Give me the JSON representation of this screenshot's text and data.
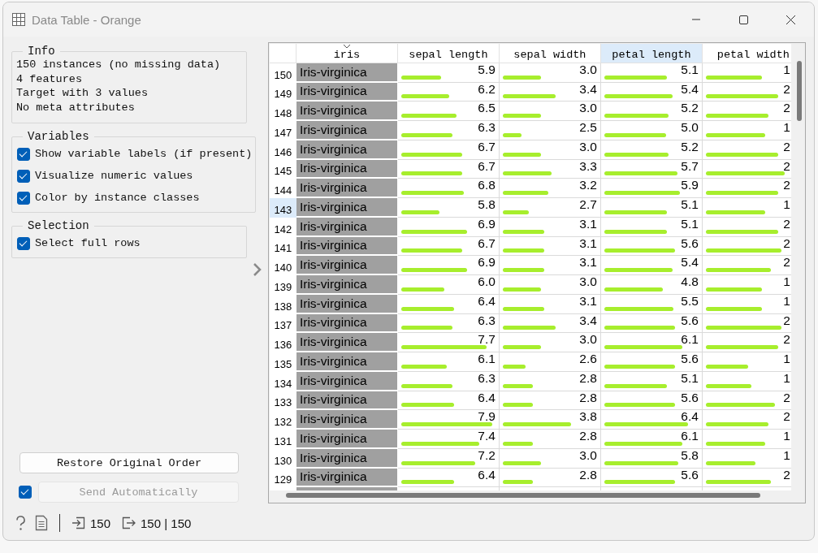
{
  "window": {
    "title": "Data Table - Orange"
  },
  "info": {
    "title": "Info",
    "lines": [
      "150 instances (no missing data)",
      "4 features",
      "Target with 3 values",
      "No meta attributes"
    ]
  },
  "variables": {
    "title": "Variables",
    "options": [
      {
        "label": "Show variable labels (if present)",
        "checked": true
      },
      {
        "label": "Visualize numeric values",
        "checked": true
      },
      {
        "label": "Color by instance classes",
        "checked": true
      }
    ]
  },
  "selection": {
    "title": "Selection",
    "options": [
      {
        "label": "Select full rows",
        "checked": true
      }
    ]
  },
  "restore_button": {
    "label": "Restore Original Order"
  },
  "send": {
    "checked": true,
    "label": "Send Automatically",
    "disabled": true
  },
  "table": {
    "columns": [
      {
        "label": "iris",
        "current": false,
        "sorted": true
      },
      {
        "label": "sepal length",
        "current": false,
        "sorted": false
      },
      {
        "label": "sepal width",
        "current": false,
        "sorted": false
      },
      {
        "label": "petal length",
        "current": true,
        "sorted": false
      },
      {
        "label": "petal width",
        "current": false,
        "sorted": false
      }
    ],
    "rows": [
      {
        "index": "150",
        "class": "Iris-virginica",
        "current": false,
        "values": [
          {
            "text": "5.9",
            "level": 0.44
          },
          {
            "text": "3.0",
            "level": 0.42
          },
          {
            "text": "5.1",
            "level": 0.69
          },
          {
            "text": "1",
            "level": 0.71
          }
        ]
      },
      {
        "index": "149",
        "class": "Iris-virginica",
        "current": false,
        "values": [
          {
            "text": "6.2",
            "level": 0.53
          },
          {
            "text": "3.4",
            "level": 0.58
          },
          {
            "text": "5.4",
            "level": 0.75
          },
          {
            "text": "2",
            "level": 0.92
          }
        ]
      },
      {
        "index": "148",
        "class": "Iris-virginica",
        "current": false,
        "values": [
          {
            "text": "6.5",
            "level": 0.61
          },
          {
            "text": "3.0",
            "level": 0.42
          },
          {
            "text": "5.2",
            "level": 0.71
          },
          {
            "text": "2",
            "level": 0.79
          }
        ]
      },
      {
        "index": "147",
        "class": "Iris-virginica",
        "current": false,
        "values": [
          {
            "text": "6.3",
            "level": 0.56
          },
          {
            "text": "2.5",
            "level": 0.21
          },
          {
            "text": "5.0",
            "level": 0.68
          },
          {
            "text": "1",
            "level": 0.75
          }
        ]
      },
      {
        "index": "146",
        "class": "Iris-virginica",
        "current": false,
        "values": [
          {
            "text": "6.7",
            "level": 0.67
          },
          {
            "text": "3.0",
            "level": 0.42
          },
          {
            "text": "5.2",
            "level": 0.71
          },
          {
            "text": "2",
            "level": 0.92
          }
        ]
      },
      {
        "index": "145",
        "class": "Iris-virginica",
        "current": false,
        "values": [
          {
            "text": "6.7",
            "level": 0.67
          },
          {
            "text": "3.3",
            "level": 0.54
          },
          {
            "text": "5.7",
            "level": 0.8
          },
          {
            "text": "2",
            "level": 1
          }
        ]
      },
      {
        "index": "144",
        "class": "Iris-virginica",
        "current": false,
        "values": [
          {
            "text": "6.8",
            "level": 0.69
          },
          {
            "text": "3.2",
            "level": 0.5
          },
          {
            "text": "5.9",
            "level": 0.83
          },
          {
            "text": "2",
            "level": 0.92
          }
        ]
      },
      {
        "index": "143",
        "class": "Iris-virginica",
        "current": true,
        "values": [
          {
            "text": "5.8",
            "level": 0.42
          },
          {
            "text": "2.7",
            "level": 0.29
          },
          {
            "text": "5.1",
            "level": 0.69
          },
          {
            "text": "1",
            "level": 0.75
          }
        ]
      },
      {
        "index": "142",
        "class": "Iris-virginica",
        "current": false,
        "values": [
          {
            "text": "6.9",
            "level": 0.72
          },
          {
            "text": "3.1",
            "level": 0.46
          },
          {
            "text": "5.1",
            "level": 0.69
          },
          {
            "text": "2",
            "level": 0.92
          }
        ]
      },
      {
        "index": "141",
        "class": "Iris-virginica",
        "current": false,
        "values": [
          {
            "text": "6.7",
            "level": 0.67
          },
          {
            "text": "3.1",
            "level": 0.46
          },
          {
            "text": "5.6",
            "level": 0.78
          },
          {
            "text": "2",
            "level": 0.96
          }
        ]
      },
      {
        "index": "140",
        "class": "Iris-virginica",
        "current": false,
        "values": [
          {
            "text": "6.9",
            "level": 0.72
          },
          {
            "text": "3.1",
            "level": 0.46
          },
          {
            "text": "5.4",
            "level": 0.75
          },
          {
            "text": "2",
            "level": 0.83
          }
        ]
      },
      {
        "index": "139",
        "class": "Iris-virginica",
        "current": false,
        "values": [
          {
            "text": "6.0",
            "level": 0.47
          },
          {
            "text": "3.0",
            "level": 0.42
          },
          {
            "text": "4.8",
            "level": 0.64
          },
          {
            "text": "1",
            "level": 0.71
          }
        ]
      },
      {
        "index": "138",
        "class": "Iris-virginica",
        "current": false,
        "values": [
          {
            "text": "6.4",
            "level": 0.58
          },
          {
            "text": "3.1",
            "level": 0.46
          },
          {
            "text": "5.5",
            "level": 0.76
          },
          {
            "text": "1",
            "level": 0.71
          }
        ]
      },
      {
        "index": "137",
        "class": "Iris-virginica",
        "current": false,
        "values": [
          {
            "text": "6.3",
            "level": 0.56
          },
          {
            "text": "3.4",
            "level": 0.58
          },
          {
            "text": "5.6",
            "level": 0.78
          },
          {
            "text": "2",
            "level": 0.96
          }
        ]
      },
      {
        "index": "136",
        "class": "Iris-virginica",
        "current": false,
        "values": [
          {
            "text": "7.7",
            "level": 0.94
          },
          {
            "text": "3.0",
            "level": 0.42
          },
          {
            "text": "6.1",
            "level": 0.86
          },
          {
            "text": "2",
            "level": 0.92
          }
        ]
      },
      {
        "index": "135",
        "class": "Iris-virginica",
        "current": false,
        "values": [
          {
            "text": "6.1",
            "level": 0.5
          },
          {
            "text": "2.6",
            "level": 0.25
          },
          {
            "text": "5.6",
            "level": 0.78
          },
          {
            "text": "1",
            "level": 0.54
          }
        ]
      },
      {
        "index": "134",
        "class": "Iris-virginica",
        "current": false,
        "values": [
          {
            "text": "6.3",
            "level": 0.56
          },
          {
            "text": "2.8",
            "level": 0.33
          },
          {
            "text": "5.1",
            "level": 0.69
          },
          {
            "text": "1",
            "level": 0.58
          }
        ]
      },
      {
        "index": "133",
        "class": "Iris-virginica",
        "current": false,
        "values": [
          {
            "text": "6.4",
            "level": 0.58
          },
          {
            "text": "2.8",
            "level": 0.33
          },
          {
            "text": "5.6",
            "level": 0.78
          },
          {
            "text": "2",
            "level": 0.88
          }
        ]
      },
      {
        "index": "132",
        "class": "Iris-virginica",
        "current": false,
        "values": [
          {
            "text": "7.9",
            "level": 1
          },
          {
            "text": "3.8",
            "level": 0.75
          },
          {
            "text": "6.4",
            "level": 0.92
          },
          {
            "text": "2",
            "level": 0.79
          }
        ]
      },
      {
        "index": "131",
        "class": "Iris-virginica",
        "current": false,
        "values": [
          {
            "text": "7.4",
            "level": 0.86
          },
          {
            "text": "2.8",
            "level": 0.33
          },
          {
            "text": "6.1",
            "level": 0.86
          },
          {
            "text": "1",
            "level": 0.75
          }
        ]
      },
      {
        "index": "130",
        "class": "Iris-virginica",
        "current": false,
        "values": [
          {
            "text": "7.2",
            "level": 0.81
          },
          {
            "text": "3.0",
            "level": 0.42
          },
          {
            "text": "5.8",
            "level": 0.81
          },
          {
            "text": "1",
            "level": 0.63
          }
        ]
      },
      {
        "index": "129",
        "class": "Iris-virginica",
        "current": false,
        "values": [
          {
            "text": "6.4",
            "level": 0.58
          },
          {
            "text": "2.8",
            "level": 0.33
          },
          {
            "text": "5.6",
            "level": 0.78
          },
          {
            "text": "2",
            "level": 0.83
          }
        ]
      }
    ]
  },
  "status_bar": {
    "input": "150",
    "output": "150 | 150"
  }
}
